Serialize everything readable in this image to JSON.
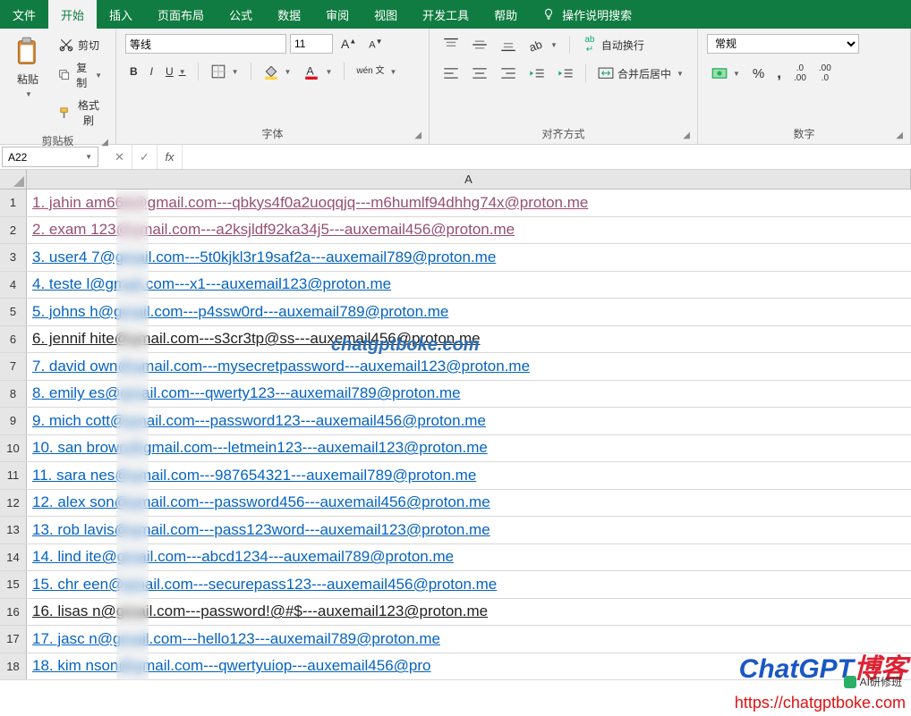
{
  "menu": {
    "tabs": [
      "文件",
      "开始",
      "插入",
      "页面布局",
      "公式",
      "数据",
      "审阅",
      "视图",
      "开发工具",
      "帮助"
    ],
    "active_index": 1,
    "search_label": "操作说明搜索"
  },
  "ribbon": {
    "clipboard": {
      "paste": "粘贴",
      "cut": "剪切",
      "copy": "复制",
      "format_painter": "格式刷",
      "label": "剪贴板"
    },
    "font": {
      "label": "字体",
      "name": "等线",
      "size": "11",
      "bold": "B",
      "italic": "I",
      "underline": "U",
      "wen": "wén 文"
    },
    "alignment": {
      "label": "对齐方式",
      "wrap": "自动换行",
      "merge": "合并后居中"
    },
    "number": {
      "label": "数字",
      "format": "常规"
    }
  },
  "formula_bar": {
    "name_box": "A22",
    "formula": ""
  },
  "grid": {
    "column_header": "A",
    "rows": [
      {
        "n": 1,
        "style": "visited",
        "text": "1. jahin   am668@gmail.com---qbkys4f0a2uoqqjq---m6humlf94dhhg74x@proton.me"
      },
      {
        "n": 2,
        "style": "visited",
        "text": "2. exam   123@gmail.com---a2ksjldf92ka34j5---auxemail456@proton.me"
      },
      {
        "n": 3,
        "style": "link",
        "text": "3. user4   7@gmail.com---5t0kjkl3r19saf2a---auxemail789@proton.me"
      },
      {
        "n": 4,
        "style": "link",
        "text": "4. teste   l@gmail.com---x1---auxemail123@proton.me"
      },
      {
        "n": 5,
        "style": "link",
        "text": "5. johns   h@gmail.com---p4ssw0rd---auxemail789@proton.me"
      },
      {
        "n": 6,
        "style": "plain",
        "text": "6. jennif   hite@gmail.com---s3cr3tp@ss---auxemail456@proton.me"
      },
      {
        "n": 7,
        "style": "link",
        "text": "7. david   own@gmail.com---mysecretpassword---auxemail123@proton.me"
      },
      {
        "n": 8,
        "style": "link",
        "text": "8. emily   es@gmail.com---qwerty123---auxemail789@proton.me"
      },
      {
        "n": 9,
        "style": "link",
        "text": "9. mich   cott@gmail.com---password123---auxemail456@proton.me"
      },
      {
        "n": 10,
        "style": "link",
        "text": "10. san   brown@gmail.com---letmein123---auxemail123@proton.me"
      },
      {
        "n": 11,
        "style": "link",
        "text": "11. sara   nes@gmail.com---987654321---auxemail789@proton.me"
      },
      {
        "n": 12,
        "style": "link",
        "text": "12. alex   son@gmail.com---password456---auxemail456@proton.me"
      },
      {
        "n": 13,
        "style": "link",
        "text": "13. rob   lavis@gmail.com---pass123word---auxemail123@proton.me"
      },
      {
        "n": 14,
        "style": "link",
        "text": "14. lind   ite@gmail.com---abcd1234---auxemail789@proton.me"
      },
      {
        "n": 15,
        "style": "link",
        "text": "15. chr   een@gmail.com---securepass123---auxemail456@proton.me"
      },
      {
        "n": 16,
        "style": "plain",
        "text": "16. lisas   n@gmail.com---password!@#$---auxemail123@proton.me"
      },
      {
        "n": 17,
        "style": "link",
        "text": "17. jasc   n@gmail.com---hello123---auxemail789@proton.me"
      },
      {
        "n": 18,
        "style": "link",
        "text": "18. kim   nson@gmail.com---qwertyuiop---auxemail456@pro"
      }
    ]
  },
  "watermark": {
    "mid_url": "chatgptboke.com",
    "logo_blue": "ChatGPT",
    "logo_red": "博客",
    "sub": "AI研修班",
    "bottom_url": "https://chatgptboke.com"
  }
}
